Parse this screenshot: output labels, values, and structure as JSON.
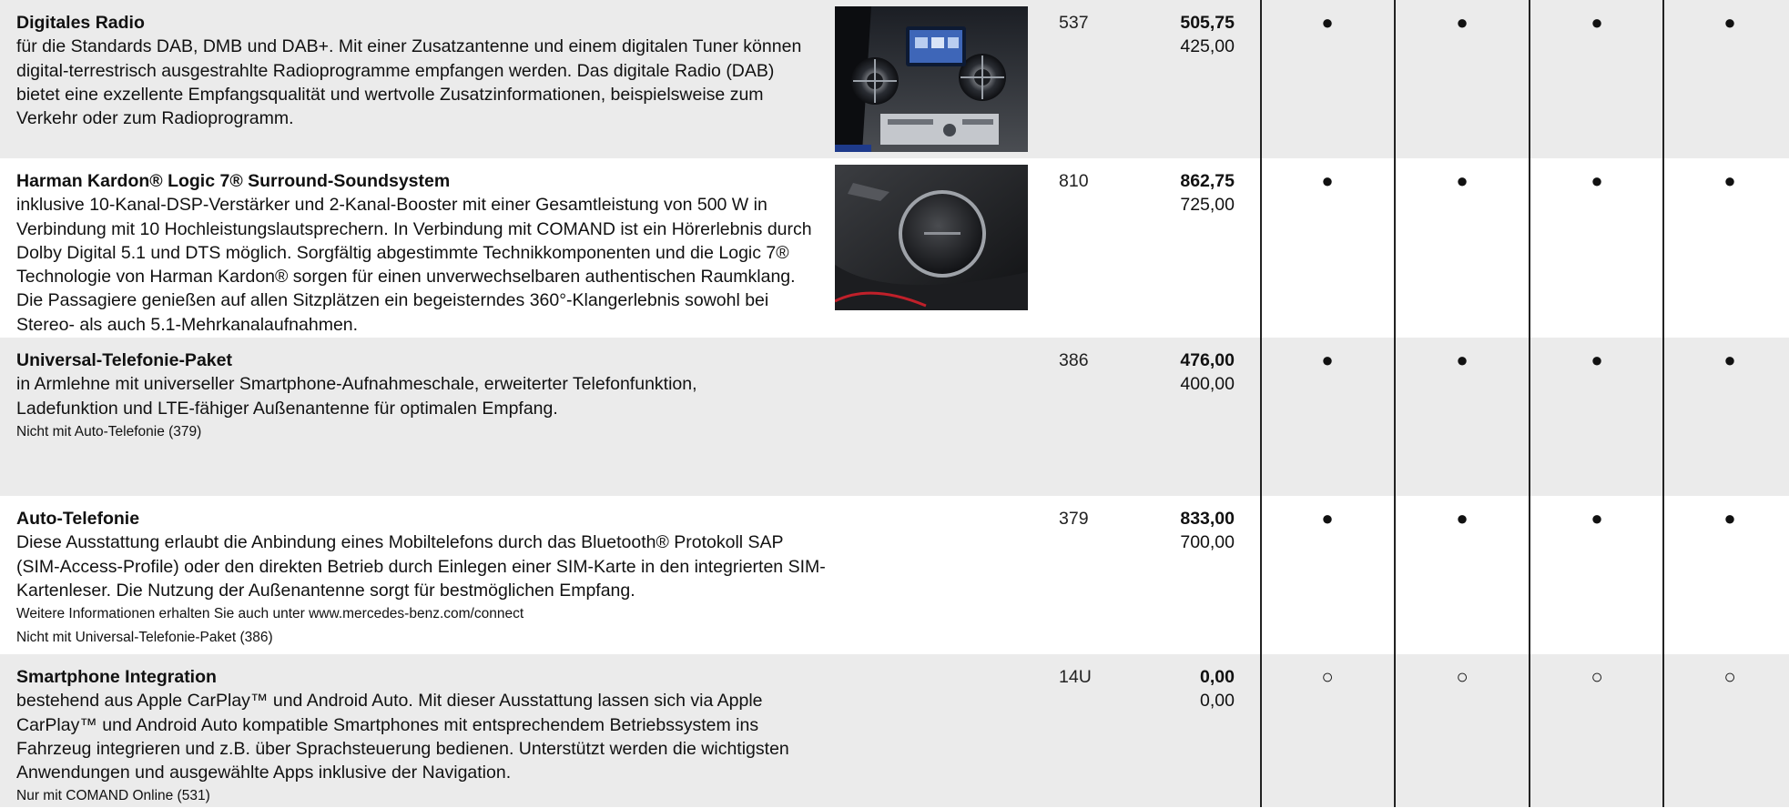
{
  "rows": [
    {
      "title": "Digitales Radio",
      "body": "für die Standards DAB, DMB und DAB+. Mit einer Zusatzantenne und einem digitalen Tuner können digital-terrestrisch ausgestrahlte Radioprogramme empfangen werden. Das digitale Radio (DAB) bietet eine exzellente Empfangsqualität und wertvolle Zusatzinformationen, beispielsweise zum Verkehr oder zum Radioprogramm.",
      "notes": [],
      "code": "537",
      "gross": "505,75",
      "net": "425,00",
      "marks": [
        "●",
        "●",
        "●",
        "●"
      ]
    },
    {
      "title": "Harman Kardon® Logic 7® Surround-Soundsystem",
      "body": "inklusive 10-Kanal-DSP-Verstärker und 2-Kanal-Booster mit einer Gesamtleistung von 500 W in Verbindung mit 10 Hochleistungslautsprechern. In Verbindung mit COMAND ist ein Hörerlebnis durch Dolby Digital 5.1 und DTS möglich. Sorgfältig abgestimmte Technikkomponenten und die Logic 7® Technologie von Harman Kardon® sorgen für einen unverwechselbaren authentischen Raumklang. Die Passagiere genießen auf allen Sitzplätzen ein begeisterndes 360°-Klangerlebnis sowohl bei Stereo- als auch 5.1-Mehrkanalaufnahmen.",
      "notes": [],
      "code": "810",
      "gross": "862,75",
      "net": "725,00",
      "marks": [
        "●",
        "●",
        "●",
        "●"
      ]
    },
    {
      "title": "Universal-Telefonie-Paket",
      "body": "in Armlehne mit universeller Smartphone-Aufnahmeschale, erweiterter Telefonfunktion, Ladefunktion und LTE-fähiger Außenantenne für optimalen Empfang.",
      "notes": [
        "Nicht mit Auto-Telefonie (379)"
      ],
      "code": "386",
      "gross": "476,00",
      "net": "400,00",
      "marks": [
        "●",
        "●",
        "●",
        "●"
      ]
    },
    {
      "title": "Auto-Telefonie",
      "body": "Diese Ausstattung erlaubt die Anbindung eines Mobiltelefons durch das Bluetooth® Protokoll SAP (SIM-Access-Profile) oder den direkten Betrieb durch Einlegen einer SIM-Karte in den integrierten SIM-Kartenleser. Die Nutzung der Außenantenne sorgt für bestmöglichen Empfang.",
      "notes": [
        "Weitere Informationen erhalten Sie auch unter www.mercedes-benz.com/connect",
        "Nicht mit Universal-Telefonie-Paket (386)"
      ],
      "code": "379",
      "gross": "833,00",
      "net": "700,00",
      "marks": [
        "●",
        "●",
        "●",
        "●"
      ]
    },
    {
      "title": "Smartphone Integration",
      "body": "bestehend aus Apple CarPlay™ und Android Auto. Mit dieser Ausstattung lassen sich via Apple CarPlay™ und Android Auto kompatible Smartphones mit entsprechendem Betriebssystem ins Fahrzeug integrieren und z.B. über Sprachsteuerung bedienen. Unterstützt werden die wichtigsten Anwendungen und ausgewählte Apps inklusive der Navigation.",
      "notes": [
        "Nur mit COMAND Online (531)"
      ],
      "code": "14U",
      "gross": "0,00",
      "net": "0,00",
      "marks": [
        "○",
        "○",
        "○",
        "○"
      ]
    }
  ],
  "images": [
    "radio-dashboard-photo",
    "speaker-door-photo"
  ]
}
